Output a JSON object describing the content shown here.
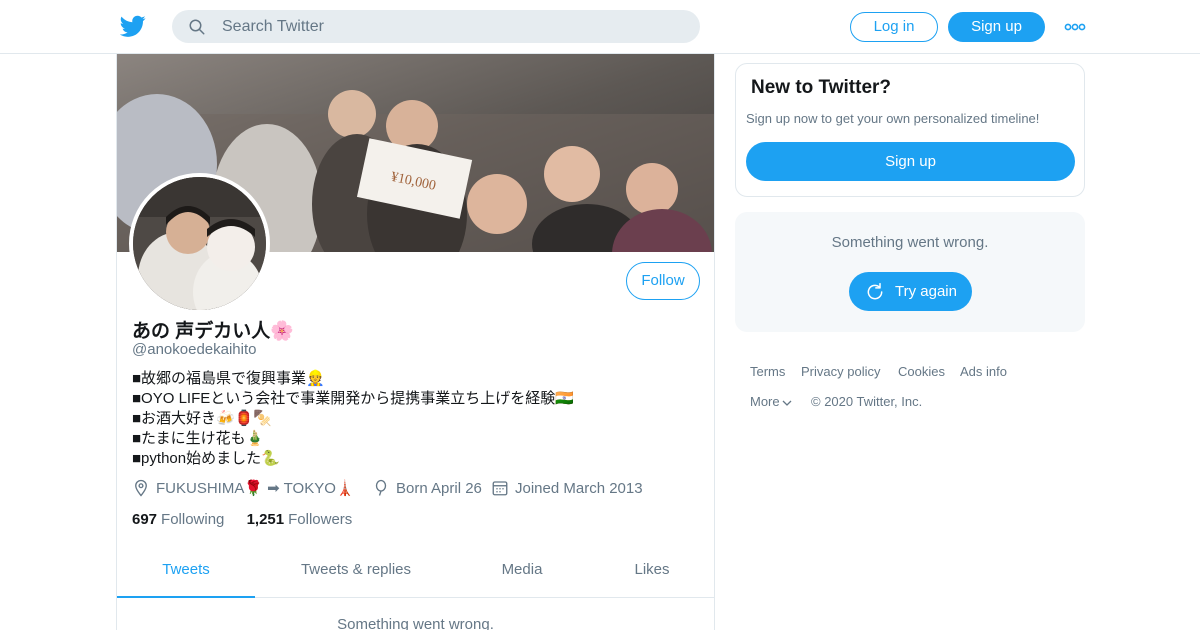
{
  "header": {
    "search_placeholder": "Search Twitter",
    "login_label": "Log in",
    "signup_label": "Sign up",
    "brand_color": "#1da1f2"
  },
  "profile": {
    "display_name": "あの 声デカい人🌸",
    "handle": "@anokoedekaihito",
    "follow_label": "Follow",
    "bio": [
      "■故郷の福島県で復興事業👷",
      "■OYO LIFEという会社で事業開発から提携事業立ち上げを経験🇮🇳",
      "■お酒大好き🍻🏮🍢",
      "■たまに生け花も🎍",
      "■python始めました🐍"
    ],
    "location": "FUKUSHIMA🌹 ➡ TOKYO🗼",
    "birthday": "Born April 26",
    "joined": "Joined March 2013",
    "following_count": "697",
    "following_label": "Following",
    "followers_count": "1,251",
    "followers_label": "Followers",
    "tabs": [
      "Tweets",
      "Tweets & replies",
      "Media",
      "Likes"
    ],
    "active_tab": "Tweets",
    "error_text": "Something went wrong."
  },
  "sidebar": {
    "new_title": "New to Twitter?",
    "new_subtitle": "Sign up now to get your own personalized timeline!",
    "new_signup_label": "Sign up",
    "error_text": "Something went wrong.",
    "try_again_label": "Try again",
    "footer_links": [
      "Terms",
      "Privacy policy",
      "Cookies",
      "Ads info"
    ],
    "more_label": "More",
    "copyright": "© 2020 Twitter, Inc."
  }
}
